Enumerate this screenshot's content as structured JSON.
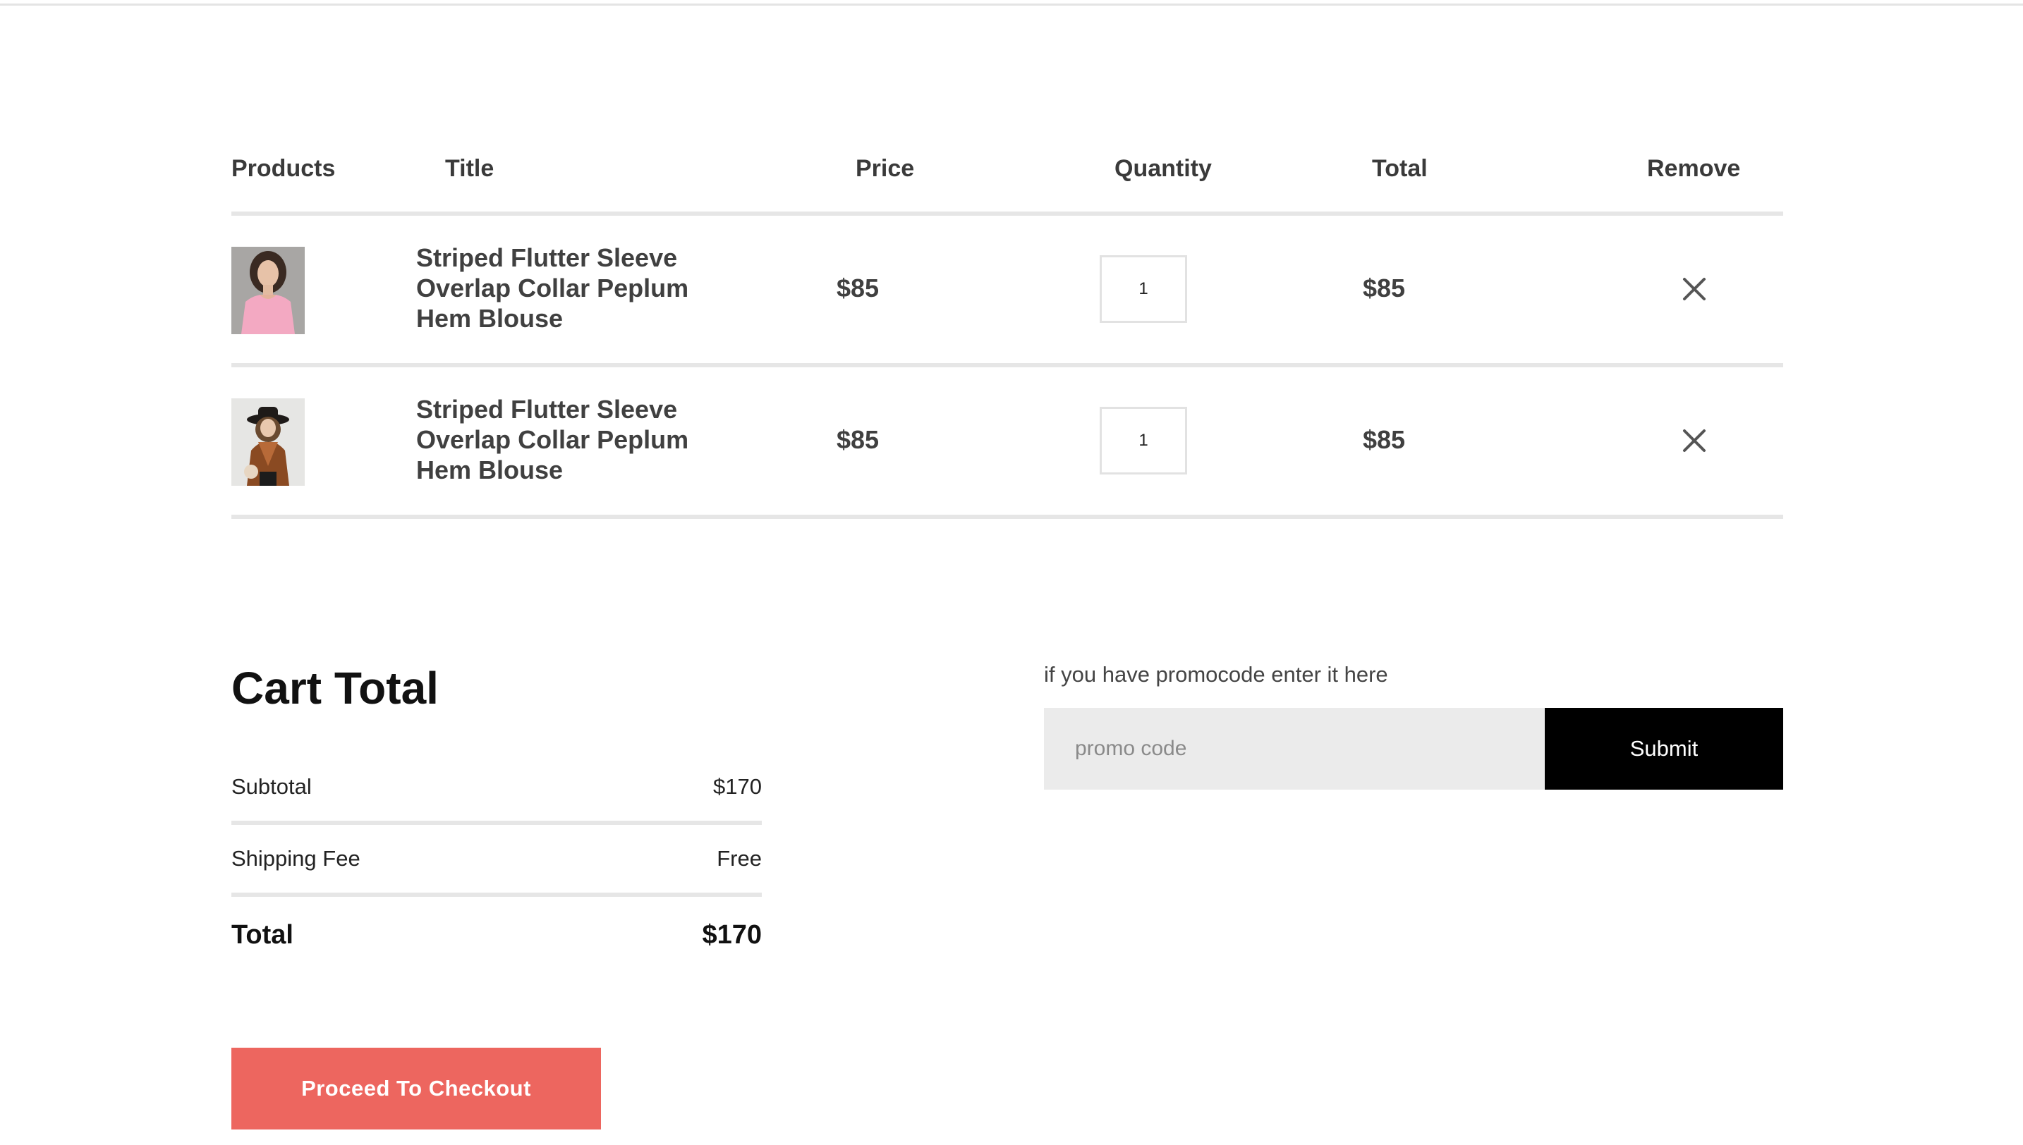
{
  "cart": {
    "headers": {
      "products": "Products",
      "title": "Title",
      "price": "Price",
      "quantity": "Quantity",
      "total": "Total",
      "remove": "Remove"
    },
    "items": [
      {
        "title": "Striped Flutter Sleeve Overlap Collar Peplum Hem Blouse",
        "price": "$85",
        "quantity": "1",
        "total": "$85"
      },
      {
        "title": "Striped Flutter Sleeve Overlap Collar Peplum Hem Blouse",
        "price": "$85",
        "quantity": "1",
        "total": "$85"
      }
    ]
  },
  "summary": {
    "title": "Cart Total",
    "subtotal_label": "Subtotal",
    "subtotal_value": "$170",
    "shipping_label": "Shipping Fee",
    "shipping_value": "Free",
    "total_label": "Total",
    "total_value": "$170",
    "checkout_label": "Proceed To Checkout"
  },
  "promo": {
    "label": "if you have promocode enter it here",
    "placeholder": "promo code",
    "submit_label": "Submit"
  },
  "colors": {
    "checkout_accent": "#ed665f",
    "submit_background": "#000000"
  }
}
